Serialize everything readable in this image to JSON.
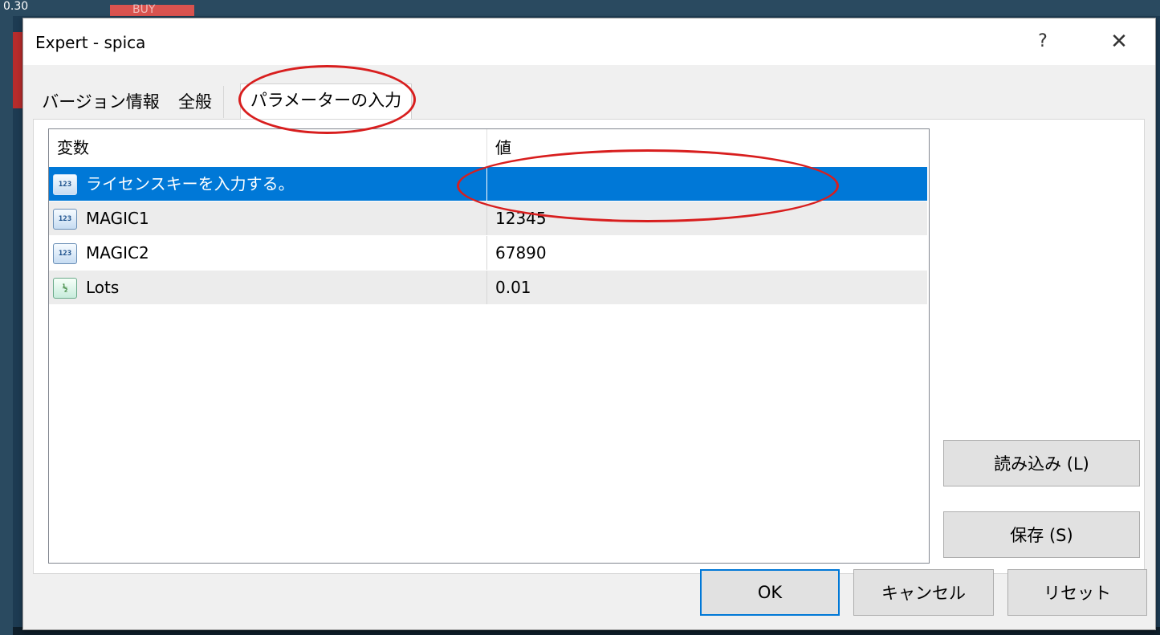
{
  "background": {
    "price_text": "0.30",
    "buy_label": "BUY"
  },
  "dialog": {
    "title": "Expert - spica",
    "help_label": "?",
    "close_label": "✕"
  },
  "tabs": [
    {
      "label": "バージョン情報",
      "active": false
    },
    {
      "label": "全般",
      "active": false
    },
    {
      "label": "パラメーターの入力",
      "active": true
    }
  ],
  "table": {
    "columns": [
      "変数",
      "値"
    ],
    "rows": [
      {
        "icon": "integer-icon",
        "icon_text": "123",
        "name": "ライセンスキーを入力する。",
        "value": "",
        "selected": true
      },
      {
        "icon": "integer-icon",
        "icon_text": "123",
        "name": "MAGIC1",
        "value": "12345",
        "selected": false
      },
      {
        "icon": "integer-icon",
        "icon_text": "123",
        "name": "MAGIC2",
        "value": "67890",
        "selected": false
      },
      {
        "icon": "fraction-icon",
        "icon_text": "½",
        "name": "Lots",
        "value": "0.01",
        "selected": false
      }
    ]
  },
  "buttons": {
    "load": "読み込み (L)",
    "save": "保存 (S)",
    "ok": "OK",
    "cancel": "キャンセル",
    "reset": "リセット"
  },
  "colors": {
    "selection": "#0078d7",
    "annotation": "#d81e1e"
  }
}
